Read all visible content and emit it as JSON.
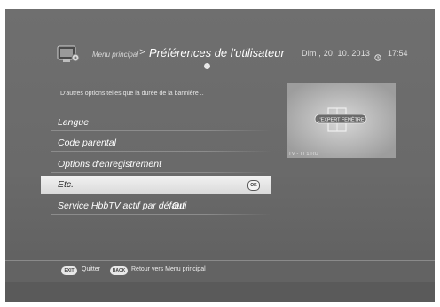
{
  "header": {
    "breadcrumb": "Menu principal",
    "separator": ">",
    "title": "Préférences de l'utilisateur",
    "date": "Dim , 20. 10. 2013",
    "time": "17:54"
  },
  "description": "D'autres options telles que la durée de la bannière ..",
  "menu": {
    "items": [
      {
        "label": "Langue"
      },
      {
        "label": "Code parental"
      },
      {
        "label": "Options d'enregistrement"
      },
      {
        "label": "Etc.",
        "selected": true,
        "badge": "OK"
      },
      {
        "label": "Service HbbTV actif par défaut",
        "value": "Oui"
      }
    ]
  },
  "preview": {
    "logo_text": "L'EXPERT FENÊTRE",
    "watermark": "TV - TF1.RU"
  },
  "footer": {
    "exit_key": "EXIT",
    "exit_label": "Quitter",
    "back_key": "BACK",
    "back_label": "Retour vers Menu principal"
  },
  "icons": {
    "header": "settings-tv-icon",
    "clock": "clock-icon"
  }
}
